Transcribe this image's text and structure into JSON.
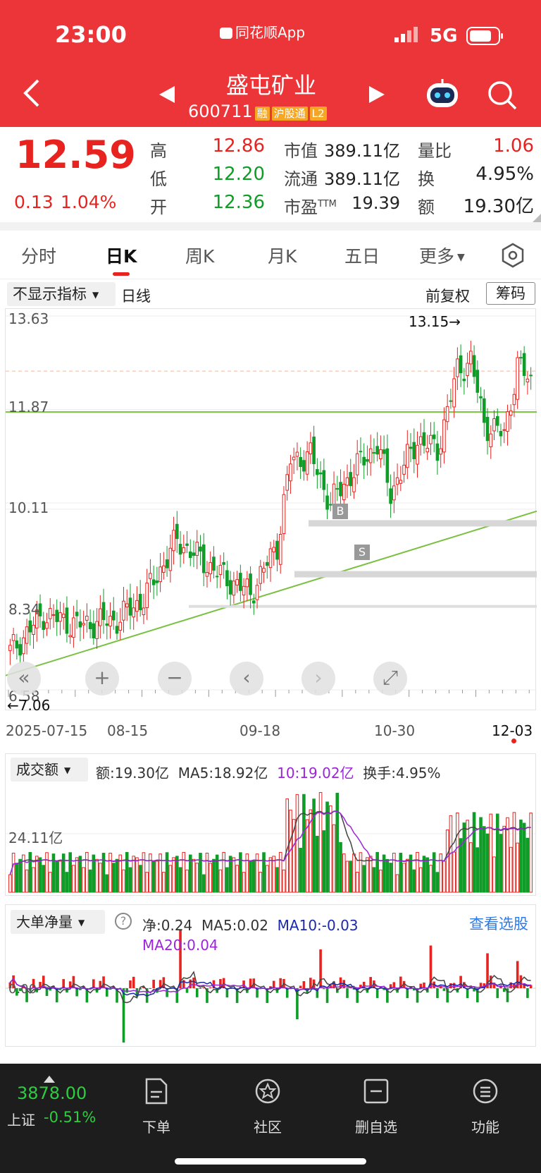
{
  "status": {
    "time": "23:00",
    "app_label": "同花顺App",
    "network": "5G"
  },
  "header": {
    "name": "盛屯矿业",
    "code": "600711",
    "tags": [
      "融",
      "沪股通",
      "L2"
    ]
  },
  "quote": {
    "price": "12.59",
    "change": "0.13",
    "change_pct": "1.04%",
    "left_labels": [
      "高",
      "低",
      "开"
    ],
    "left_values": [
      "12.86",
      "12.20",
      "12.36"
    ],
    "mid_labels": [
      "市值",
      "流通",
      "市盈"
    ],
    "mid_sup": "TTM",
    "mid_values": [
      "389.11亿",
      "389.11亿",
      "19.39"
    ],
    "right_labels": [
      "量比",
      "换",
      "额"
    ],
    "right_values": [
      "1.06",
      "4.95%",
      "19.30亿"
    ]
  },
  "tabs": [
    "分时",
    "日K",
    "周K",
    "月K",
    "五日",
    "更多"
  ],
  "kline": {
    "indicator_label": "不显示指标",
    "period": "日线",
    "adjust": "前复权",
    "chip_button": "筹码",
    "y_labels": [
      "13.63",
      "11.87",
      "10.11",
      "8.34",
      "6.58"
    ],
    "max_label": "13.15→",
    "min_label": "←7.06",
    "x_labels": [
      "2025-07-15",
      "08-15",
      "09-18",
      "10-30",
      "12-03"
    ],
    "markers": [
      "B",
      "S"
    ]
  },
  "chart_data": {
    "type": "candlestick",
    "ylim": [
      6.58,
      13.63
    ],
    "x": [
      "2025-07-15",
      "08-15",
      "09-18",
      "10-30",
      "12-03"
    ],
    "close_last": 12.59,
    "high_max": 13.15,
    "low_min": 7.06
  },
  "volume": {
    "selector": "成交额",
    "amount": "额:19.30亿",
    "ma5": "MA5:18.92亿",
    "ma10": "10:19.02亿",
    "turnover": "换手:4.95%",
    "y_label": "24.11亿"
  },
  "bigorder": {
    "selector": "大单净量",
    "net": "净:0.24",
    "ma5": "MA5:0.02",
    "ma10": "MA10:-0.03",
    "ma20": "MA20:0.04",
    "link": "查看选股",
    "y_label": "0.00"
  },
  "bottom": {
    "index_value": "3878.00",
    "index_name": "上证",
    "index_change": "-0.51%",
    "items": [
      "下单",
      "社区",
      "删自选",
      "功能"
    ]
  },
  "colors": {
    "header": "#ec3539",
    "up": "#e8231f",
    "down": "#0f9d28"
  }
}
